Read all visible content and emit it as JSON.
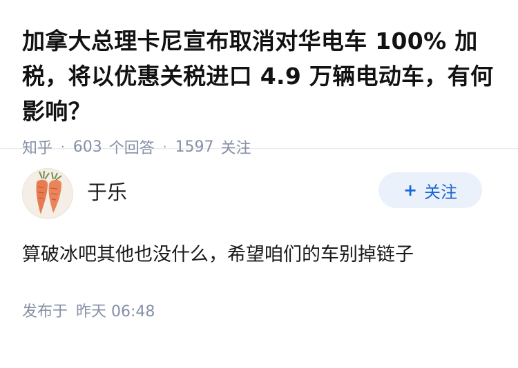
{
  "question": {
    "title": "加拿大总理卡尼宣布取消对华电车 100% 加税，将以优惠关税进口 4.9 万辆电动车，有何影响？",
    "source": "知乎",
    "answers_count": "603",
    "answers_label": "个回答",
    "followers_count": "1597",
    "followers_label": "关注"
  },
  "answer": {
    "author_name": "于乐",
    "follow_button": {
      "icon": "+",
      "label": "关注"
    },
    "content": "算破冰吧其他也没什么，希望咱们的车别掉链子",
    "published_label": "发布于",
    "published_time": "昨天 06:48"
  },
  "colors": {
    "meta": "#8590a6",
    "follow_bg": "#ebf1fb",
    "follow_text": "#1766d6"
  },
  "icons": {
    "avatar": "carrot-pair-avatar"
  }
}
